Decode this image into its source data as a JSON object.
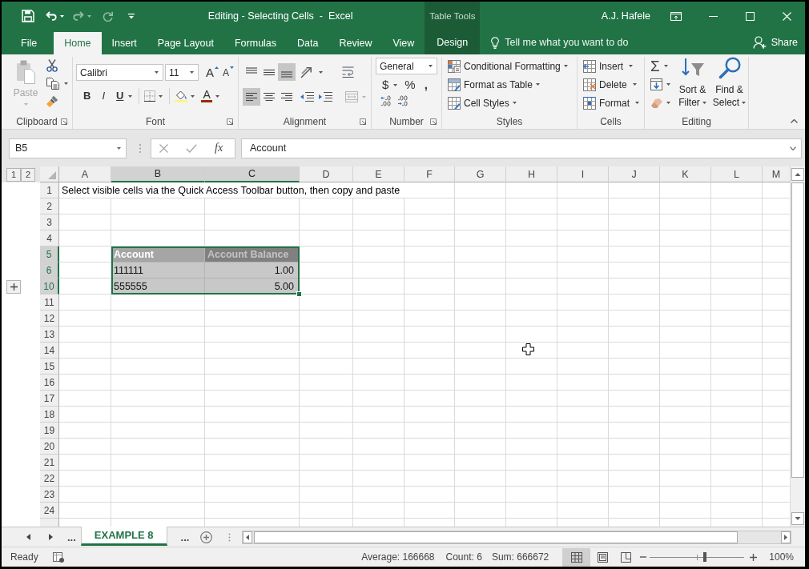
{
  "title_bar": {
    "quick_access": [
      {
        "kind": "save",
        "disabled": false
      },
      {
        "kind": "undo",
        "disabled": false
      },
      {
        "kind": "redo",
        "disabled": true
      },
      {
        "kind": "repeat",
        "disabled": true
      },
      {
        "kind": "customize",
        "disabled": false
      }
    ],
    "title": "Editing - Selecting Cells  -  Excel",
    "context_group": "Table Tools",
    "user": "A.J. Hafele"
  },
  "ribbon_tabs": [
    {
      "label": "File",
      "kind": "backstage",
      "selected": false
    },
    {
      "label": "Home",
      "kind": "standard",
      "selected": true
    },
    {
      "label": "Insert",
      "kind": "standard",
      "selected": false
    },
    {
      "label": "Page Layout",
      "kind": "standard",
      "selected": false
    },
    {
      "label": "Formulas",
      "kind": "standard",
      "selected": false
    },
    {
      "label": "Data",
      "kind": "standard",
      "selected": false
    },
    {
      "label": "Review",
      "kind": "standard",
      "selected": false
    },
    {
      "label": "View",
      "kind": "standard",
      "selected": false
    },
    {
      "label": "Design",
      "kind": "contextual",
      "selected": false
    }
  ],
  "tell_me": {
    "placeholder": "Tell me what you want to do"
  },
  "share": "Share",
  "ribbon": {
    "clipboard": {
      "label": "Clipboard",
      "paste": "Paste",
      "paste_disabled": true
    },
    "font": {
      "label": "Font",
      "font_name": "Calibri",
      "font_size": "11",
      "grow": "A",
      "shrink": "A",
      "bold": "B",
      "italic": "I",
      "underline": "U",
      "font_color": "A"
    },
    "alignment": {
      "label": "Alignment",
      "vertical": [
        {
          "kind": "top",
          "selected": false
        },
        {
          "kind": "middle",
          "selected": false
        },
        {
          "kind": "bottom",
          "selected": true
        }
      ],
      "horizontal": [
        {
          "kind": "left",
          "selected": true
        },
        {
          "kind": "center",
          "selected": false
        },
        {
          "kind": "right",
          "selected": false
        }
      ],
      "merge_disabled": true
    },
    "number": {
      "label": "Number",
      "format": "General",
      "currency": "$",
      "percent": "%",
      "comma": ","
    },
    "styles": {
      "label": "Styles",
      "commands": [
        "Conditional Formatting",
        "Format as Table",
        "Cell Styles"
      ]
    },
    "cells": {
      "label": "Cells",
      "commands": [
        "Insert",
        "Delete",
        "Format"
      ]
    },
    "editing": {
      "label": "Editing",
      "autosum": "Σ",
      "commands": [
        "Sort & Filter",
        "Find & Select"
      ]
    }
  },
  "formula_bar": {
    "name_box": "B5",
    "insert_function": "fx",
    "formula": "Account"
  },
  "sheet": {
    "outline_levels": [
      "1",
      "2"
    ],
    "columns": [
      {
        "label": "A",
        "selected": false
      },
      {
        "label": "B",
        "selected": true
      },
      {
        "label": "C",
        "selected": true
      },
      {
        "label": "D",
        "selected": false
      },
      {
        "label": "E",
        "selected": false
      },
      {
        "label": "F",
        "selected": false
      },
      {
        "label": "G",
        "selected": false
      },
      {
        "label": "H",
        "selected": false
      },
      {
        "label": "I",
        "selected": false
      },
      {
        "label": "J",
        "selected": false
      },
      {
        "label": "K",
        "selected": false
      },
      {
        "label": "L",
        "selected": false
      },
      {
        "label": "M",
        "selected": false
      }
    ],
    "rows": [
      {
        "label": "1",
        "selected": false,
        "group_collapsed": false
      },
      {
        "label": "2",
        "selected": false,
        "group_collapsed": false
      },
      {
        "label": "3",
        "selected": false,
        "group_collapsed": false
      },
      {
        "label": "4",
        "selected": false,
        "group_collapsed": false
      },
      {
        "label": "5",
        "selected": true,
        "group_collapsed": false
      },
      {
        "label": "6",
        "selected": true,
        "group_collapsed": false
      },
      {
        "label": "10",
        "selected": true,
        "group_collapsed": true
      },
      {
        "label": "11",
        "selected": false,
        "group_collapsed": false
      },
      {
        "label": "12",
        "selected": false,
        "group_collapsed": false
      },
      {
        "label": "13",
        "selected": false,
        "group_collapsed": false
      },
      {
        "label": "14",
        "selected": false,
        "group_collapsed": false
      },
      {
        "label": "15",
        "selected": false,
        "group_collapsed": false
      },
      {
        "label": "16",
        "selected": false,
        "group_collapsed": false
      },
      {
        "label": "17",
        "selected": false,
        "group_collapsed": false
      },
      {
        "label": "18",
        "selected": false,
        "group_collapsed": false
      },
      {
        "label": "19",
        "selected": false,
        "group_collapsed": false
      },
      {
        "label": "20",
        "selected": false,
        "group_collapsed": false
      },
      {
        "label": "21",
        "selected": false,
        "group_collapsed": false
      },
      {
        "label": "22",
        "selected": false,
        "group_collapsed": false
      },
      {
        "label": "23",
        "selected": false,
        "group_collapsed": false
      },
      {
        "label": "24",
        "selected": false,
        "group_collapsed": false
      }
    ],
    "note": "Select visible cells via the Quick Access Toolbar button, then copy and paste",
    "table": {
      "selected": true,
      "headers": [
        "Account",
        "Account Balance"
      ],
      "rows": [
        [
          "111111",
          "1.00"
        ],
        [
          "555555",
          "5.00"
        ]
      ]
    }
  },
  "sheet_tabs": {
    "before": "...",
    "tabs": [
      {
        "label": "EXAMPLE 8",
        "selected": true
      }
    ],
    "after": "..."
  },
  "status_bar": {
    "mode": "Ready",
    "average": "Average: 166668",
    "count": "Count: 6",
    "sum": "Sum: 666672",
    "views": [
      {
        "kind": "normal",
        "selected": true
      },
      {
        "kind": "page_layout",
        "selected": false
      },
      {
        "kind": "page_break",
        "selected": false
      }
    ],
    "zoom_slider": {
      "level": 0.58
    },
    "zoom": "100%"
  }
}
